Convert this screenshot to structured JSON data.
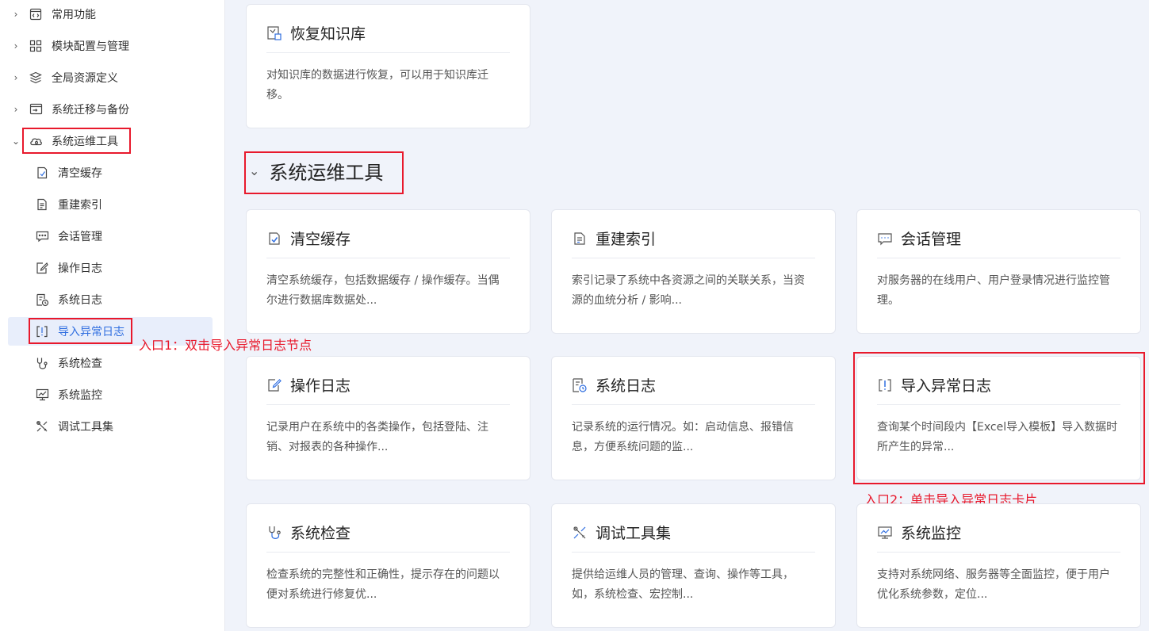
{
  "sidebar": {
    "items": [
      {
        "label": "常用功能",
        "icon": "code-window-icon",
        "chevron": "›"
      },
      {
        "label": "模块配置与管理",
        "icon": "grid-icon",
        "chevron": "›"
      },
      {
        "label": "全局资源定义",
        "icon": "layers-icon",
        "chevron": "›"
      },
      {
        "label": "系统迁移与备份",
        "icon": "migrate-icon",
        "chevron": "›"
      },
      {
        "label": "系统运维工具",
        "icon": "cloud-tool-icon",
        "chevron": "⌄"
      }
    ],
    "children": [
      {
        "label": "清空缓存",
        "icon": "clear-cache-icon"
      },
      {
        "label": "重建索引",
        "icon": "rebuild-index-icon"
      },
      {
        "label": "会话管理",
        "icon": "chat-icon"
      },
      {
        "label": "操作日志",
        "icon": "edit-log-icon"
      },
      {
        "label": "系统日志",
        "icon": "system-log-icon"
      },
      {
        "label": "导入异常日志",
        "icon": "import-error-icon"
      },
      {
        "label": "系统检查",
        "icon": "stethoscope-icon"
      },
      {
        "label": "系统监控",
        "icon": "monitor-icon"
      },
      {
        "label": "调试工具集",
        "icon": "tools-icon"
      }
    ]
  },
  "annotations": {
    "entry1": "入口1：双击导入异常日志节点",
    "entry2": "入口2：单击导入异常日志卡片"
  },
  "section": {
    "chevron": "⌄",
    "title": "系统运维工具"
  },
  "cards": [
    {
      "title": "恢复知识库",
      "desc": "对知识库的数据进行恢复，可以用于知识库迁移。",
      "icon": "restore-icon"
    },
    {
      "title": "清空缓存",
      "desc": "清空系统缓存，包括数据缓存 / 操作缓存。当偶尔进行数据库数据处...",
      "icon": "clear-cache-icon"
    },
    {
      "title": "重建索引",
      "desc": "索引记录了系统中各资源之间的关联关系，当资源的血统分析 / 影响...",
      "icon": "rebuild-index-icon"
    },
    {
      "title": "会话管理",
      "desc": "对服务器的在线用户、用户登录情况进行监控管理。",
      "icon": "chat-icon"
    },
    {
      "title": "操作日志",
      "desc": "记录用户在系统中的各类操作，包括登陆、注销、对报表的各种操作...",
      "icon": "edit-log-icon"
    },
    {
      "title": "系统日志",
      "desc": "记录系统的运行情况。如：启动信息、报错信息，方便系统问题的监...",
      "icon": "system-log-icon"
    },
    {
      "title": "导入异常日志",
      "desc": "查询某个时间段内【Excel导入模板】导入数据时所产生的异常...",
      "icon": "import-error-icon"
    },
    {
      "title": "系统检查",
      "desc": "检查系统的完整性和正确性，提示存在的问题以便对系统进行修复优...",
      "icon": "stethoscope-icon"
    },
    {
      "title": "调试工具集",
      "desc": "提供给运维人员的管理、查询、操作等工具，如，系统检查、宏控制...",
      "icon": "tools-icon"
    },
    {
      "title": "系统监控",
      "desc": "支持对系统网络、服务器等全面监控，便于用户优化系统参数，定位...",
      "icon": "monitor-icon"
    }
  ],
  "colors": {
    "accent": "#2f6ee0",
    "highlight": "#e8192c",
    "active_bg": "#e8eefb"
  }
}
